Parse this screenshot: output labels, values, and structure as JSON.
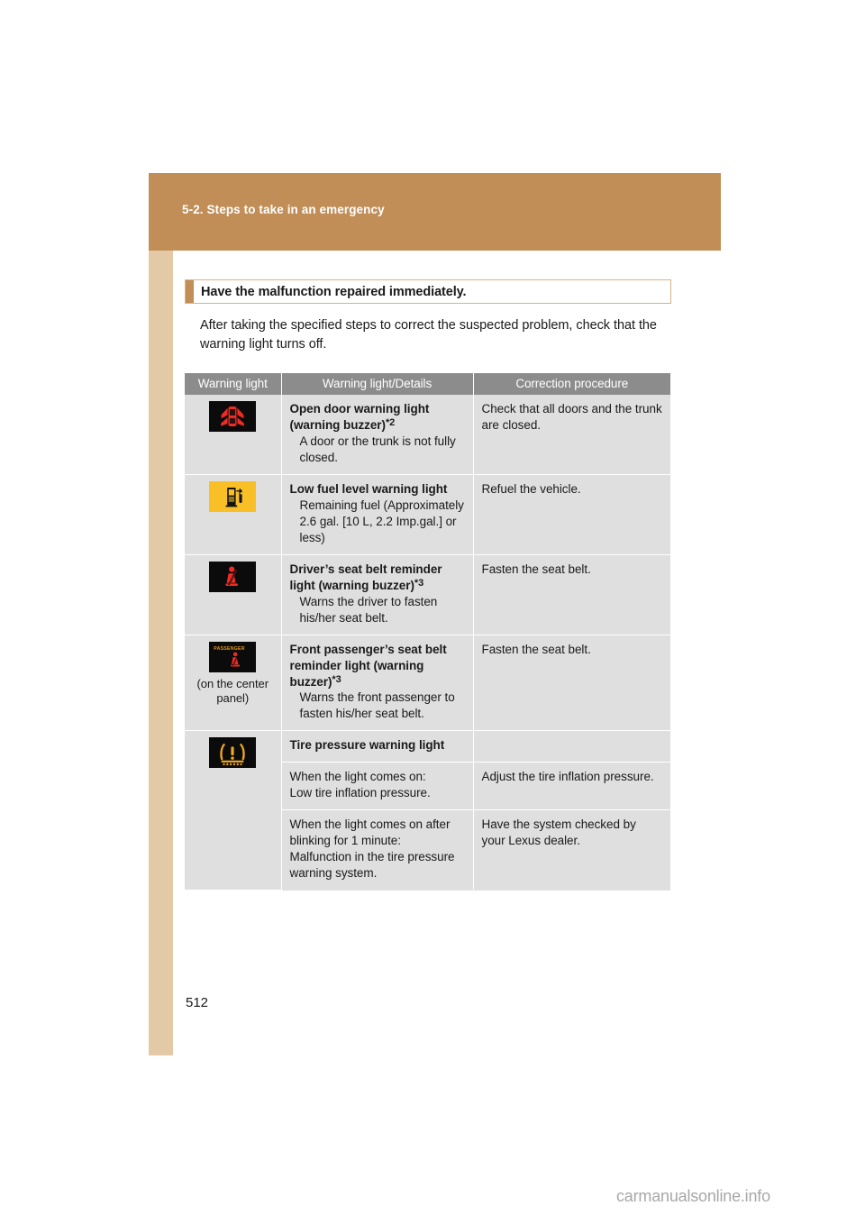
{
  "header": {
    "chapter_title": "5-2. Steps to take in an emergency",
    "band_color": "#c08e56",
    "sidebar_color": "#e3c9a6"
  },
  "section": {
    "heading": "Have the malfunction repaired immediately.",
    "paragraph": "After taking the specified steps to correct the suspected problem, check that the warning light turns off."
  },
  "table": {
    "headers": {
      "col1": "Warning light",
      "col2": "Warning light/Details",
      "col3": "Correction procedure"
    },
    "header_bg": "#8c8c8c",
    "cell_bg": "#dfdfdf",
    "rows": [
      {
        "icon_name": "open-door-warning-icon",
        "icon_note": "",
        "title": "Open door warning light (warning buzzer)",
        "footnote": "*2",
        "detail": "A door or the trunk is not fully closed.",
        "procedure": "Check that all doors and the trunk are closed."
      },
      {
        "icon_name": "low-fuel-warning-icon",
        "icon_note": "",
        "title": "Low fuel level warning light",
        "footnote": "",
        "detail": "Remaining fuel (Approximately 2.6 gal. [10 L, 2.2 Imp.gal.] or less)",
        "procedure": "Refuel the vehicle."
      },
      {
        "icon_name": "driver-seat-belt-reminder-icon",
        "icon_note": "",
        "title": "Driver’s seat belt reminder light (warning buzzer)",
        "footnote": "*3",
        "detail": "Warns the driver to fasten his/her seat belt.",
        "procedure": "Fasten the seat belt."
      },
      {
        "icon_name": "front-passenger-seat-belt-reminder-icon",
        "icon_note": "(on the center panel)",
        "icon_label": "PASSENGER",
        "title": "Front passenger’s seat belt reminder light (warning buzzer)",
        "footnote": "*3",
        "detail": "Warns the front passenger to fasten his/her seat belt.",
        "procedure": "Fasten the seat belt."
      },
      {
        "icon_name": "tire-pressure-warning-icon",
        "icon_note": "",
        "title": "Tire pressure warning light",
        "footnote": "",
        "detail": "",
        "procedure": "",
        "sub_rows": [
          {
            "detail_line1": "When the light comes on:",
            "detail_line2": "Low tire inflation pressure.",
            "procedure": "Adjust the tire inflation pressure."
          },
          {
            "detail_line1": "When the light comes on after blinking for 1 minute:",
            "detail_line2": "Malfunction in the tire pressure warning system.",
            "procedure": "Have the system checked by your Lexus dealer."
          }
        ]
      }
    ]
  },
  "footer": {
    "page_number": "512",
    "watermark": "carmanualsonline.info"
  }
}
